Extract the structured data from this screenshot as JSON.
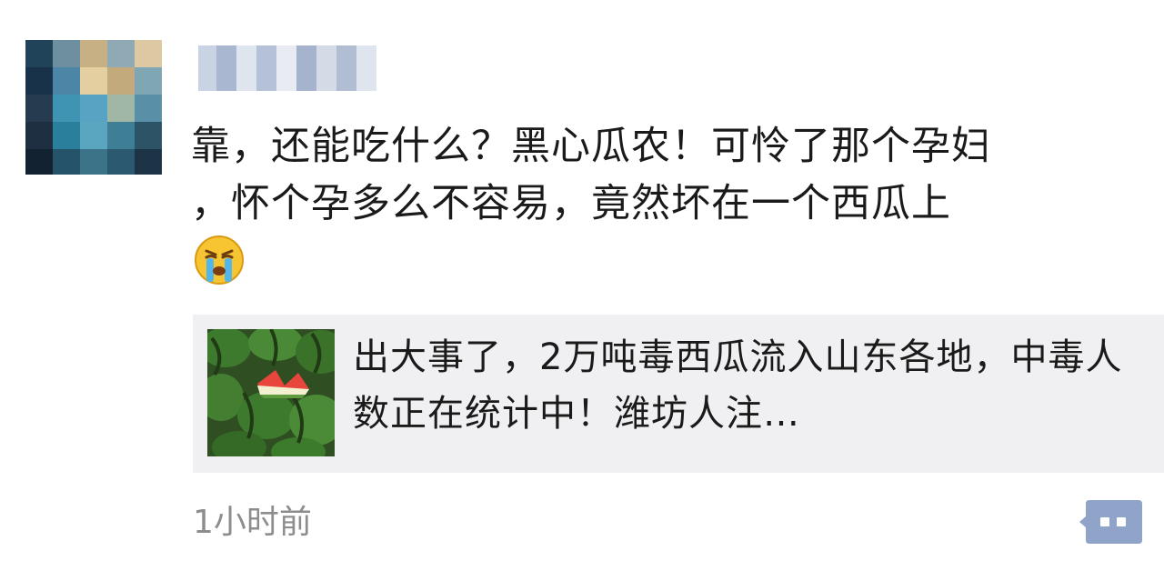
{
  "post": {
    "author_name": "",
    "text": "靠，还能吃什么？黑心瓜农！可怜了那个孕妇\n，怀个孕多么不容易，竟然坏在一个西瓜上",
    "emoji": "crying-face-emoji",
    "timestamp": "1小时前"
  },
  "link_card": {
    "title": "出大事了，2万吨毒西瓜流入山东各地，中毒人数正在统计中！潍坊人注…",
    "thumbnail": "watermelon-image"
  },
  "icons": {
    "comment": "comment-icon"
  },
  "colors": {
    "accent": "#8fa4c8",
    "card_background": "#f0f0f2",
    "timestamp": "#8d8d8d"
  }
}
